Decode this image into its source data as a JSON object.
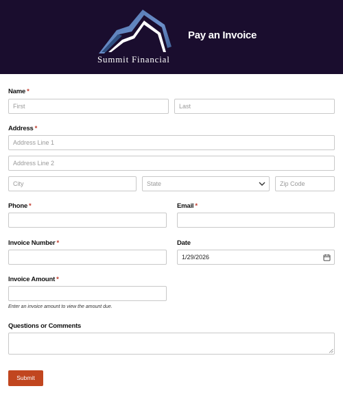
{
  "header": {
    "brand_name": "Summit Financial",
    "title": "Pay an Invoice",
    "background": "#1a0d2e"
  },
  "form": {
    "name": {
      "label": "Name",
      "first_placeholder": "First",
      "last_placeholder": "Last"
    },
    "address": {
      "label": "Address",
      "line1_placeholder": "Address Line 1",
      "line2_placeholder": "Address Line 2",
      "city_placeholder": "City",
      "state_placeholder": "State",
      "zip_placeholder": "Zip Code"
    },
    "phone": {
      "label": "Phone",
      "value": ""
    },
    "email": {
      "label": "Email",
      "value": ""
    },
    "invoice_number": {
      "label": "Invoice Number",
      "value": ""
    },
    "date": {
      "label": "Date",
      "value": "1/29/2026"
    },
    "invoice_amount": {
      "label": "Invoice Amount",
      "value": "",
      "help": "Enter an invoice amount to view the amount due."
    },
    "comments": {
      "label": "Questions or Comments",
      "value": ""
    },
    "required_marker": "*",
    "submit_label": "Submit",
    "accent_color": "#c1461f",
    "required_color": "#c0392b"
  }
}
